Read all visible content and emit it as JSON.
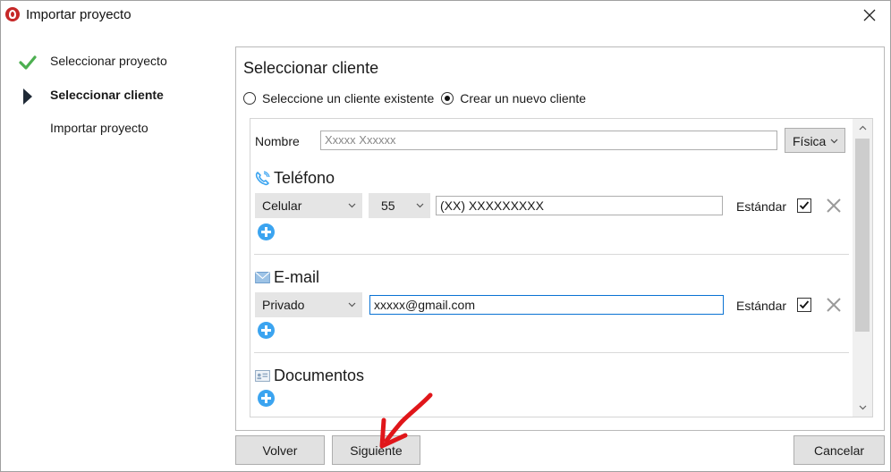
{
  "window": {
    "title": "Importar proyecto"
  },
  "steps": [
    {
      "label": "Seleccionar proyecto",
      "state": "done"
    },
    {
      "label": "Seleccionar cliente",
      "state": "active"
    },
    {
      "label": "Importar proyecto",
      "state": "pending"
    }
  ],
  "panel": {
    "title": "Seleccionar cliente",
    "radio_existing": "Seleccione un cliente existente",
    "radio_new": "Crear un nuevo cliente",
    "selected_radio": "new"
  },
  "form": {
    "name_label": "Nombre",
    "name_value": "Xxxxx Xxxxxx",
    "person_type": "Física",
    "phone": {
      "heading": "Teléfono",
      "type": "Celular",
      "country_code": "55",
      "number": "(XX) XXXXXXXXX",
      "standard_label": "Estándar",
      "standard_checked": true
    },
    "email": {
      "heading": "E-mail",
      "type": "Privado",
      "address": "xxxxx@gmail.com",
      "standard_label": "Estándar",
      "standard_checked": true
    },
    "documents": {
      "heading": "Documentos"
    }
  },
  "buttons": {
    "back": "Volver",
    "next": "Siguiente",
    "cancel": "Cancelar"
  },
  "colors": {
    "accent_blue": "#3ba4f0",
    "check_green": "#4caf50",
    "annotation_red": "#e0161a",
    "focus_border": "#0a72d3"
  },
  "icons": {
    "done_step": "checkmark-icon",
    "active_step": "triangle-right-icon",
    "phone": "phone-icon",
    "email": "envelope-icon",
    "documents": "id-card-icon",
    "add": "plus-circle-icon",
    "remove": "close-x-icon"
  }
}
